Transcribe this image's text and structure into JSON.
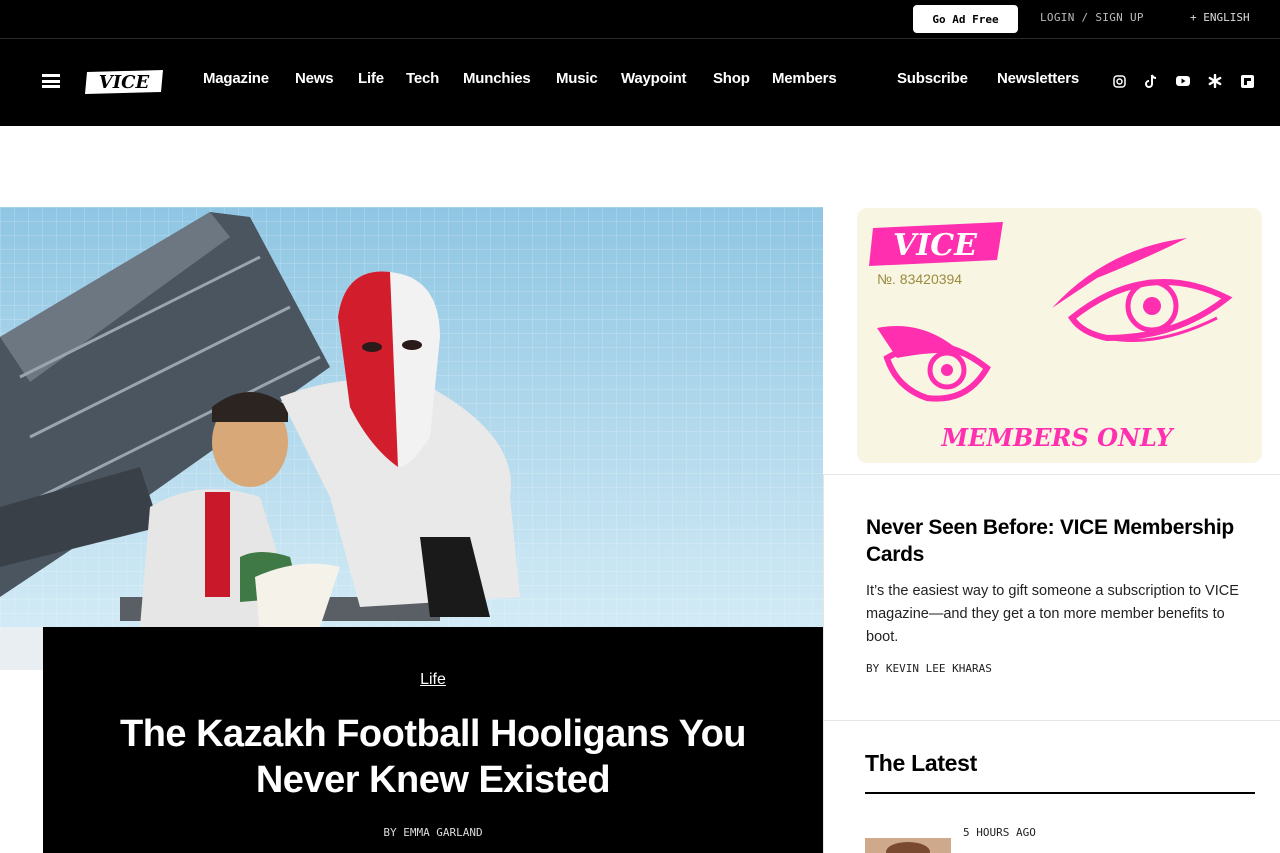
{
  "utility_bar": {
    "go_ad_free": "Go Ad Free",
    "login": "LOGIN / SIGN UP",
    "language": "+ ENGLISH"
  },
  "nav": {
    "logo_text": "VICE",
    "links": [
      "Magazine",
      "News",
      "Life",
      "Tech",
      "Munchies",
      "Music",
      "Waypoint",
      "Shop",
      "Members"
    ],
    "subscribe": "Subscribe",
    "newsletters": "Newsletters",
    "social_icons": [
      "instagram-icon",
      "tiktok-icon",
      "youtube-icon",
      "asterisk-icon",
      "flipboard-icon"
    ]
  },
  "hero": {
    "category": "Life",
    "title": "The Kazakh Football Hooligans You Never Knew Existed",
    "byline": "BY EMMA GARLAND"
  },
  "sidebar": {
    "promo_image": {
      "logo": "VICE",
      "number": "№. 83420394",
      "caption": "MEMBERS ONLY"
    },
    "promo": {
      "title": "Never Seen Before: VICE Membership Cards",
      "description": "It’s the easiest way to gift someone a subscription to VICE magazine—and they get a ton more member benefits to boot.",
      "byline": "BY KEVIN LEE KHARAS"
    },
    "latest": {
      "heading": "The Latest",
      "items": [
        {
          "time": "5 HOURS AGO"
        }
      ]
    }
  },
  "colors": {
    "nav_bg": "#000000",
    "accent_pink": "#ff2fb0",
    "card_bg": "#f8f6e2"
  }
}
